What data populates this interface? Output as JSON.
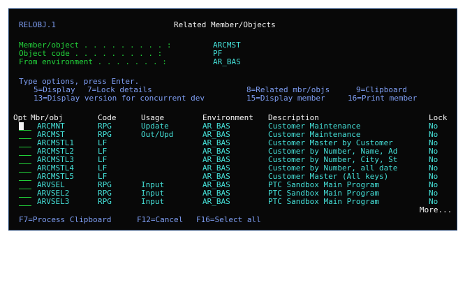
{
  "header": {
    "program": "RELOBJ.1",
    "title": "Related Member/Objects"
  },
  "info": {
    "member_label": "Member/object . . . . . . . . . :",
    "member_value": "ARCMST",
    "objcode_label": "Object code . . . . . . . . . :",
    "objcode_value": "PF",
    "env_label": "From environment . . . . . . . :",
    "env_value": "AR_BAS"
  },
  "instructions": {
    "prompt": "Type options, press Enter.",
    "opt5": "5=Display",
    "opt7": "7=Lock details",
    "opt8": "8=Related mbr/objs",
    "opt9": "9=Clipboard",
    "opt13": "13=Display version for concurrent dev",
    "opt15": "15=Display member",
    "opt16": "16=Print member"
  },
  "table": {
    "headers": {
      "opt": "Opt",
      "mbr": "Mbr/obj",
      "code": "Code",
      "usage": "Usage",
      "env": "Environment",
      "desc": "Description",
      "lock": "Lock"
    },
    "rows": [
      {
        "mbr": "ARCMNT",
        "code": "RPG",
        "usage": "Update",
        "env": "AR_BAS",
        "desc": "Customer Maintenance",
        "lock": "No"
      },
      {
        "mbr": "ARCMST",
        "code": "RPG",
        "usage": "Out/Upd",
        "env": "AR_BAS",
        "desc": "Customer Maintenance",
        "lock": "No"
      },
      {
        "mbr": "ARCMSTL1",
        "code": "LF",
        "usage": "",
        "env": "AR_BAS",
        "desc": "Customer Master by Customer",
        "lock": "No"
      },
      {
        "mbr": "ARCMSTL2",
        "code": "LF",
        "usage": "",
        "env": "AR_BAS",
        "desc": "Customer by Number, Name, Ad",
        "lock": "No"
      },
      {
        "mbr": "ARCMSTL3",
        "code": "LF",
        "usage": "",
        "env": "AR_BAS",
        "desc": "Customer by Number, City, St",
        "lock": "No"
      },
      {
        "mbr": "ARCMSTL4",
        "code": "LF",
        "usage": "",
        "env": "AR_BAS",
        "desc": "Customer by Number, all date",
        "lock": "No"
      },
      {
        "mbr": "ARCMSTL5",
        "code": "LF",
        "usage": "",
        "env": "AR_BAS",
        "desc": "Customer Master (All keys)",
        "lock": "No"
      },
      {
        "mbr": "ARVSEL",
        "code": "RPG",
        "usage": "Input",
        "env": "AR_BAS",
        "desc": "PTC Sandbox Main Program",
        "lock": "No"
      },
      {
        "mbr": "ARVSEL2",
        "code": "RPG",
        "usage": "Input",
        "env": "AR_BAS",
        "desc": "PTC Sandbox Main Program",
        "lock": "No"
      },
      {
        "mbr": "ARVSEL3",
        "code": "RPG",
        "usage": "Input",
        "env": "AR_BAS",
        "desc": "PTC Sandbox Main Program",
        "lock": "No"
      }
    ],
    "more": "More..."
  },
  "footer": {
    "f7": "F7=Process Clipboard",
    "f12": "F12=Cancel",
    "f16": "F16=Select all"
  },
  "colors": {
    "background": "#080808",
    "blue": "#7d9cf0",
    "green": "#22d33a",
    "white": "#f2f2f2",
    "turquoise": "#45e0d8"
  }
}
